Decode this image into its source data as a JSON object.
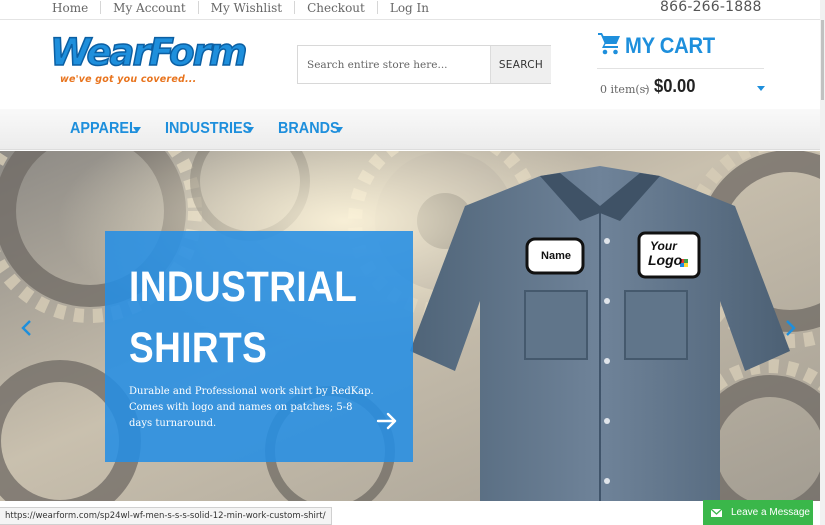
{
  "top_links": [
    "Home",
    "My Account",
    "My Wishlist",
    "Checkout",
    "Log In"
  ],
  "phone": "866-266-1888",
  "logo": {
    "word": "WearForm",
    "tagline": "we've got you covered..."
  },
  "search": {
    "placeholder": "Search entire store here...",
    "button": "SEARCH"
  },
  "cart": {
    "title": "MY CART",
    "items": "0 item(s)",
    "dash": "-",
    "total": "$0.00",
    "icon": "cart-icon"
  },
  "nav": [
    {
      "label": "APPAREL"
    },
    {
      "label": "INDUSTRIES"
    },
    {
      "label": "BRANDS"
    }
  ],
  "hero": {
    "title_line1": "INDUSTRIAL",
    "title_line2": "SHIRTS",
    "description": "Durable and Professional work shirt by RedKap. Comes with logo and names on patches; 5-8 days turnaround.",
    "patch_name": "Name",
    "patch_logo_1": "Your",
    "patch_logo_2": "Logo"
  },
  "status_url": "https://wearform.com/sp24wl-wf-men-s-s-s-solid-12-min-work-custom-shirt/",
  "chat": {
    "label": "Leave a Message"
  },
  "colors": {
    "brand_blue": "#1e8fdc",
    "promo_blue": "#268ee4",
    "chat_green": "#3ab74a",
    "logo_orange": "#e8741e"
  }
}
